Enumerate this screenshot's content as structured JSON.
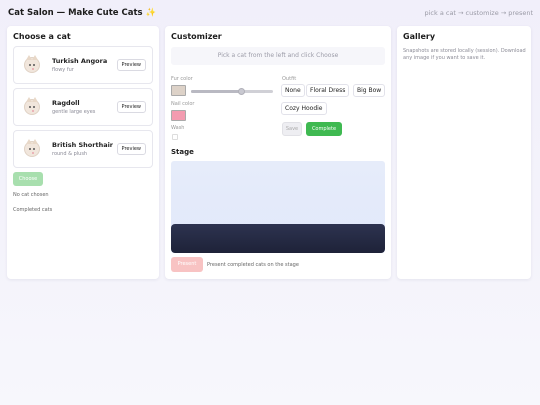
{
  "header": {
    "title": "Cat Salon — Make Cute Cats",
    "sparkle": "✨",
    "flow": "pick a cat → customize → present"
  },
  "left": {
    "title": "Choose a cat",
    "cats": [
      {
        "name": "Turkish Angora",
        "desc": "flowy fur",
        "preview_label": "Preview"
      },
      {
        "name": "Ragdoll",
        "desc": "gentle large eyes",
        "preview_label": "Preview"
      },
      {
        "name": "British Shorthair",
        "desc": "round & plush",
        "preview_label": "Preview"
      }
    ],
    "choose_label": "Choose",
    "no_cat": "No cat chosen",
    "completed": "Completed cats"
  },
  "customizer": {
    "title": "Customizer",
    "hint": "Pick a cat from the left and click Choose",
    "fur_label": "Fur color",
    "fur_color": "#ddd2c8",
    "fur_slider_value": 0.62,
    "nail_label": "Nail color",
    "nail_color": "#f39bb0",
    "wash_label": "Wash",
    "outfit_label": "Outfit",
    "outfits": [
      "None",
      "Floral Dress",
      "Big Bow",
      "Cozy Hoodie"
    ],
    "save_label": "Save",
    "complete_label": "Complete",
    "stage_title": "Stage",
    "present_label": "Present",
    "present_note": "Present completed cats on the stage"
  },
  "gallery": {
    "title": "Gallery",
    "note": "Snapshots are stored locally (session). Download any image if you want to save it."
  },
  "colors": {
    "accent_green": "#3fb951",
    "choose_disabled": "#a8dfae",
    "present_disabled": "#f8c3c3",
    "stage_dark": "#1e2238"
  }
}
